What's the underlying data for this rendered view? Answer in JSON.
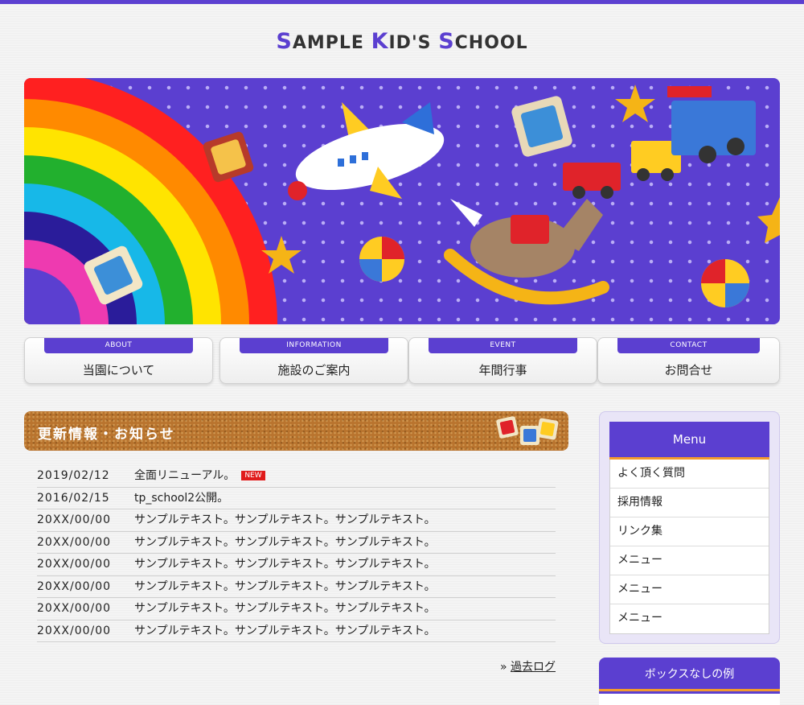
{
  "site": {
    "title_parts": [
      {
        "cap": "S",
        "rest": "AMPLE "
      },
      {
        "cap": "K",
        "rest": "ID'S "
      },
      {
        "cap": "S",
        "rest": "CHOOL"
      }
    ]
  },
  "colors": {
    "accent": "#5b3fd0",
    "orange": "#f29a2e",
    "new_badge": "#e01b1b",
    "cork": "#b9742e"
  },
  "nav": [
    {
      "tag": "ABOUT",
      "label": "当園について"
    },
    {
      "tag": "INFORMATION",
      "label": "施設のご案内"
    },
    {
      "tag": "EVENT",
      "label": "年間行事"
    },
    {
      "tag": "CONTACT",
      "label": "お問合せ"
    }
  ],
  "news": {
    "title": "更新情報・お知らせ",
    "new_label": "NEW",
    "items": [
      {
        "date": "2019/02/12",
        "text": "全面リニューアル。"
      },
      {
        "date": "2016/02/15",
        "text": "tp_school2公開。"
      },
      {
        "date": "20XX/00/00",
        "text": "サンプルテキスト。サンプルテキスト。サンプルテキスト。"
      },
      {
        "date": "20XX/00/00",
        "text": "サンプルテキスト。サンプルテキスト。サンプルテキスト。"
      },
      {
        "date": "20XX/00/00",
        "text": "サンプルテキスト。サンプルテキスト。サンプルテキスト。"
      },
      {
        "date": "20XX/00/00",
        "text": "サンプルテキスト。サンプルテキスト。サンプルテキスト。"
      },
      {
        "date": "20XX/00/00",
        "text": "サンプルテキスト。サンプルテキスト。サンプルテキスト。"
      },
      {
        "date": "20XX/00/00",
        "text": "サンプルテキスト。サンプルテキスト。サンプルテキスト。"
      }
    ],
    "past_prefix": "»",
    "past_log": "過去ログ"
  },
  "sidebar": {
    "menu_title": "Menu",
    "menu_items": [
      "よく頂く質問",
      "採用情報",
      "リンク集",
      "メニュー",
      "メニュー",
      "メニュー"
    ],
    "box2_title": "ボックスなしの例"
  }
}
